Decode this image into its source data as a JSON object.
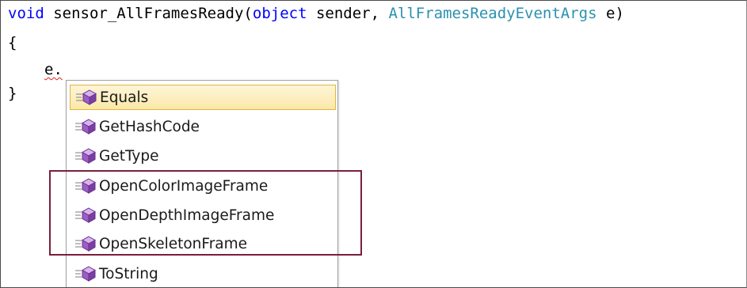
{
  "code": {
    "line1": {
      "keyword": "void",
      "method_name": " sensor_AllFramesReady(",
      "param_type1": "object",
      "param_name1": " sender, ",
      "param_type2": "AllFramesReadyEventArgs",
      "param_name2": " e)"
    },
    "line2": "{",
    "line3_typed": "e.",
    "line4": "}"
  },
  "completion_list": {
    "items": [
      {
        "label": "Equals",
        "icon": "method-icon",
        "selected": true
      },
      {
        "label": "GetHashCode",
        "icon": "method-icon",
        "selected": false
      },
      {
        "label": "GetType",
        "icon": "method-icon",
        "selected": false
      },
      {
        "label": "OpenColorImageFrame",
        "icon": "method-icon",
        "selected": false
      },
      {
        "label": "OpenDepthImageFrame",
        "icon": "method-icon",
        "selected": false
      },
      {
        "label": "OpenSkeletonFrame",
        "icon": "method-icon",
        "selected": false
      },
      {
        "label": "ToString",
        "icon": "method-icon",
        "selected": false
      }
    ]
  },
  "colors": {
    "keyword": "#0000ff",
    "type": "#2b91af",
    "highlight_border": "#7a1f3a",
    "selection_border": "#e3b63c",
    "method_icon": "#9b5fc0"
  }
}
